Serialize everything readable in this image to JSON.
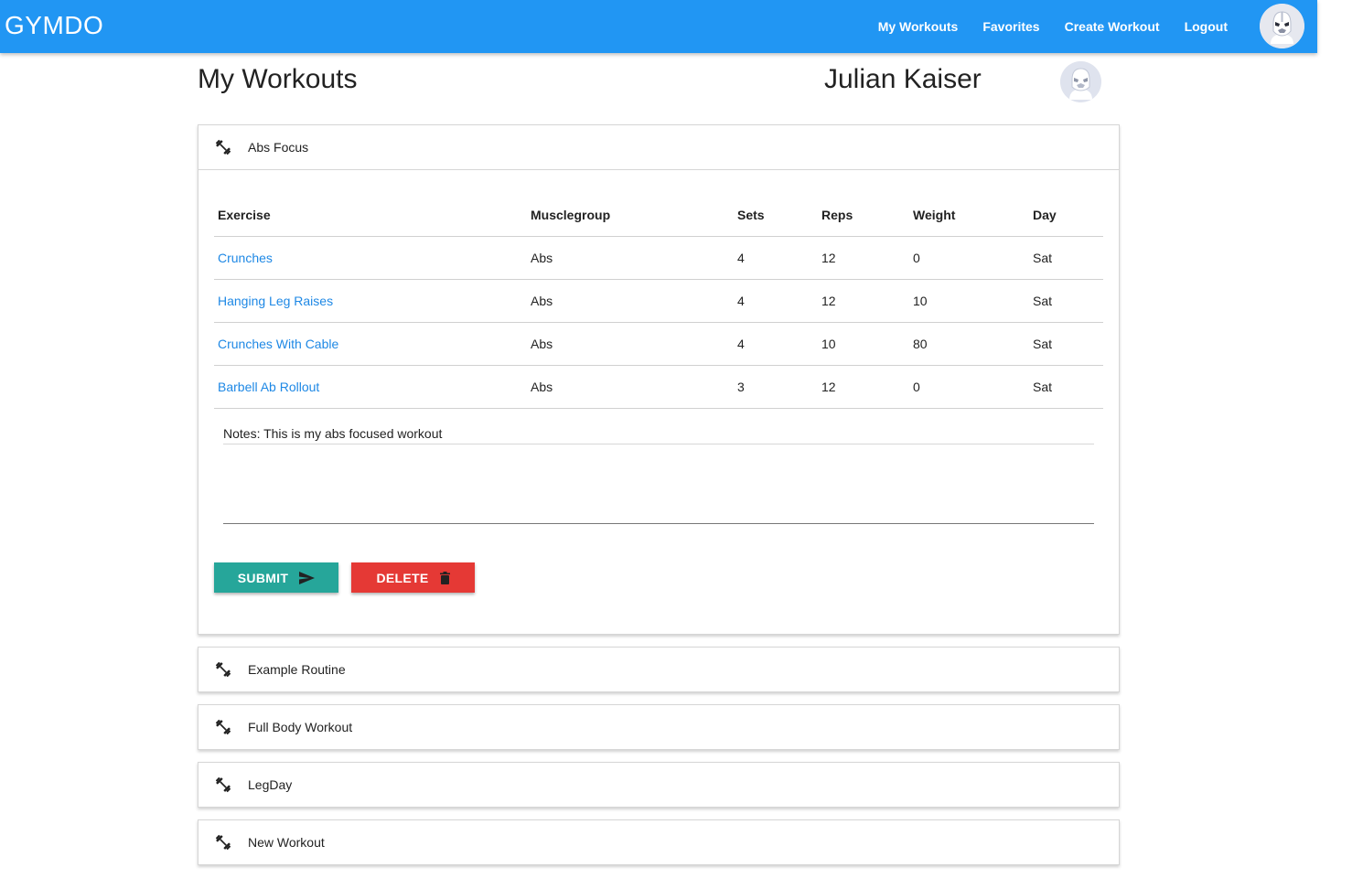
{
  "navbar": {
    "brand": "GYMDO",
    "links": [
      "My Workouts",
      "Favorites",
      "Create Workout",
      "Logout"
    ]
  },
  "header": {
    "title": "My Workouts",
    "user_name": "Julian Kaiser"
  },
  "workouts": [
    {
      "name": "Abs Focus",
      "expanded": true,
      "columns": [
        "Exercise",
        "Musclegroup",
        "Sets",
        "Reps",
        "Weight",
        "Day"
      ],
      "rows": [
        [
          "Crunches",
          "Abs",
          "4",
          "12",
          "0",
          "Sat"
        ],
        [
          "Hanging Leg Raises",
          "Abs",
          "4",
          "12",
          "10",
          "Sat"
        ],
        [
          "Crunches With Cable",
          "Abs",
          "4",
          "10",
          "80",
          "Sat"
        ],
        [
          "Barbell Ab Rollout",
          "Abs",
          "3",
          "12",
          "0",
          "Sat"
        ]
      ],
      "notes": "Notes: This is my abs focused workout",
      "submit_label": "SUBMIT",
      "delete_label": "DELETE"
    },
    {
      "name": "Example Routine"
    },
    {
      "name": "Full Body Workout"
    },
    {
      "name": "LegDay"
    },
    {
      "name": "New Workout"
    }
  ],
  "colors": {
    "navbar": "#2196f3",
    "link": "#1e88e5",
    "submit": "#26a69a",
    "delete": "#e53935"
  },
  "icons": {
    "panel": "dumbbell-icon",
    "submit": "send-icon",
    "delete": "trash-icon",
    "avatar": "stormtrooper-avatar"
  }
}
